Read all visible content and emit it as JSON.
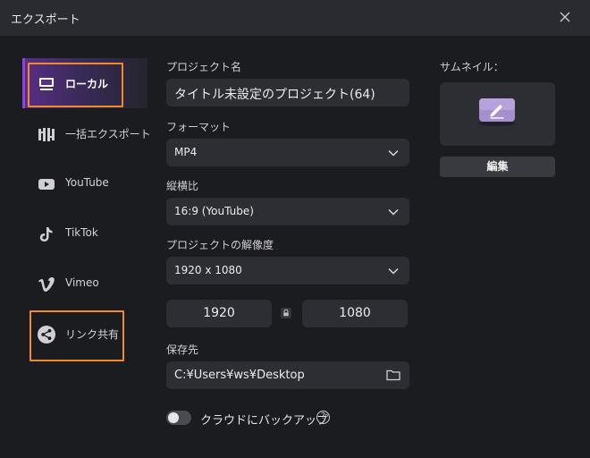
{
  "window": {
    "title": "エクスポート"
  },
  "sidebar": {
    "items": [
      {
        "label": "ローカル",
        "icon": "local-export-icon",
        "active": true
      },
      {
        "label": "一括エクスポート",
        "icon": "batch-export-icon"
      },
      {
        "label": "YouTube",
        "icon": "youtube-icon"
      },
      {
        "label": "TikTok",
        "icon": "tiktok-icon"
      },
      {
        "label": "Vimeo",
        "icon": "vimeo-icon"
      },
      {
        "label": "リンク共有",
        "icon": "share-icon"
      }
    ]
  },
  "form": {
    "project_name_label": "プロジェクト名",
    "project_name_value": "タイトル未設定のプロジェクト(64)",
    "format_label": "フォーマット",
    "format_value": "MP4",
    "aspect_label": "縦横比",
    "aspect_value": "16:9 (YouTube)",
    "resolution_label": "プロジェクトの解像度",
    "resolution_value": "1920 x 1080",
    "width_value": "1920",
    "height_value": "1080",
    "save_label": "保存先",
    "save_path": "C:¥Users¥ws¥Desktop",
    "cloud_backup_label": "クラウドにバックアップ",
    "cloud_backup_on": false,
    "help_glyph": "?"
  },
  "thumbnail": {
    "label": "サムネイル：",
    "edit_label": "編集"
  },
  "colors": {
    "accent": "#8e44d9",
    "highlight": "#f08a2c",
    "background": "#1b1c20",
    "field": "#2d2e34"
  }
}
